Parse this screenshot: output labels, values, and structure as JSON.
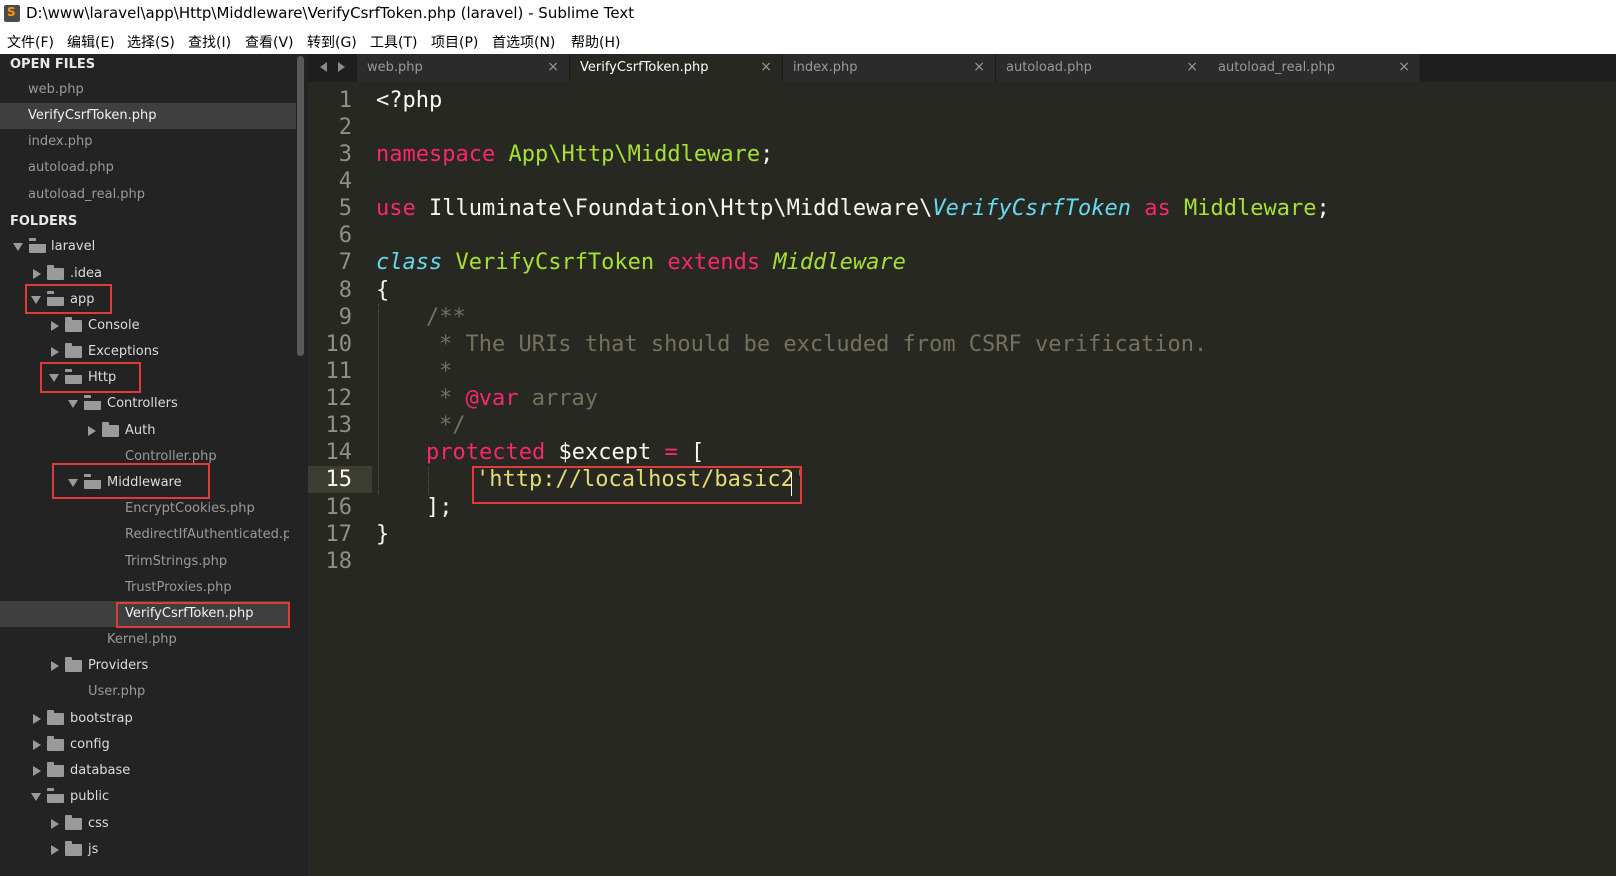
{
  "window": {
    "title": "D:\\www\\laravel\\app\\Http\\Middleware\\VerifyCsrfToken.php (laravel) - Sublime Text"
  },
  "menu": [
    "文件(F)",
    "编辑(E)",
    "选择(S)",
    "查找(I)",
    "查看(V)",
    "转到(G)",
    "工具(T)",
    "项目(P)",
    "首选项(N)",
    "帮助(H)"
  ],
  "sidebar": {
    "open_files_heading": "OPEN FILES",
    "open_files": [
      "web.php",
      "VerifyCsrfToken.php",
      "index.php",
      "autoload.php",
      "autoload_real.php"
    ],
    "folders_heading": "FOLDERS",
    "tree": [
      "laravel",
      ".idea",
      "app",
      "Console",
      "Exceptions",
      "Http",
      "Controllers",
      "Auth",
      "Controller.php",
      "Middleware",
      "EncryptCookies.php",
      "RedirectIfAuthenticated.php",
      "TrimStrings.php",
      "TrustProxies.php",
      "VerifyCsrfToken.php",
      "Kernel.php",
      "Providers",
      "User.php",
      "bootstrap",
      "config",
      "database",
      "public",
      "css",
      "js"
    ]
  },
  "tabs": [
    {
      "label": "web.php",
      "active": false
    },
    {
      "label": "VerifyCsrfToken.php",
      "active": true
    },
    {
      "label": "index.php",
      "active": false
    },
    {
      "label": "autoload.php",
      "active": false
    },
    {
      "label": "autoload_real.php",
      "active": false
    }
  ],
  "tab_close_glyph": "×",
  "editor": {
    "current_line": 15,
    "line_numbers": [
      "1",
      "2",
      "3",
      "4",
      "5",
      "6",
      "7",
      "8",
      "9",
      "10",
      "11",
      "12",
      "13",
      "14",
      "15",
      "16",
      "17",
      "18"
    ],
    "code": {
      "l1": "<?php",
      "l3_kw": "namespace",
      "l3_ns": "App\\Http\\Middleware",
      "l3_end": ";",
      "l5_kw": "use",
      "l5_path": "Illuminate\\Foundation\\Http\\Middleware\\",
      "l5_class": "VerifyCsrfToken",
      "l5_as": "as",
      "l5_alias": "Middleware",
      "l5_end": ";",
      "l7_class_kw": "class",
      "l7_name": "VerifyCsrfToken",
      "l7_extends": "extends",
      "l7_parent": "Middleware",
      "l8": "{",
      "l9": "/**",
      "l10": "* The URIs that should be excluded from CSRF verification.",
      "l11": "*",
      "l12_star": "*",
      "l12_tag": "@var",
      "l12_type": "array",
      "l13": "*/",
      "l14_kw": "protected",
      "l14_var": "$except",
      "l14_eq": "=",
      "l14_bracket": "[",
      "l15": "'http://localhost/basic2'",
      "l16": "];",
      "l17": "}"
    }
  },
  "colors": {
    "editor_bg": "#272822",
    "sidebar_bg": "#232323",
    "keyword": "#f92672",
    "class_name": "#a6e22e",
    "storage": "#66d9ef",
    "comment": "#75715e",
    "string": "#e6db74",
    "highlight_box": "#e03a3a"
  }
}
